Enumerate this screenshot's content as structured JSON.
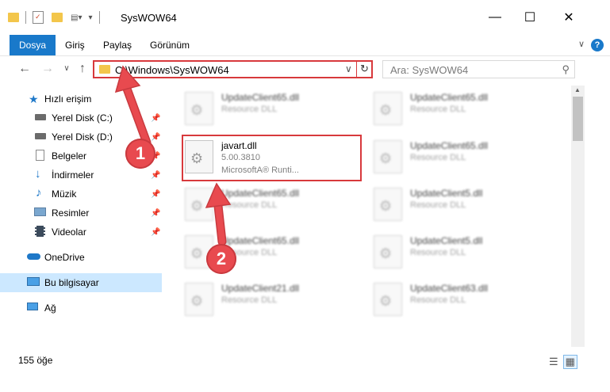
{
  "window": {
    "title": "SysWOW64",
    "minimize": "—",
    "maximize": "☐",
    "close": "✕"
  },
  "ribbon": {
    "tabs": [
      "Dosya",
      "Giriş",
      "Paylaş",
      "Görünüm"
    ],
    "help": "?",
    "collapse": "∨"
  },
  "nav": {
    "back": "←",
    "forward": "→",
    "recent": "∨",
    "up": "↑",
    "address": "C:\\Windows\\SysWOW64",
    "refresh": "↻",
    "search_placeholder": "Ara: SysWOW64",
    "search_icon": "search-icon"
  },
  "navpane": {
    "items": [
      {
        "label": "Hızlı erişim",
        "icon": "star-icon"
      },
      {
        "label": "Yerel Disk (C:)",
        "icon": "drive-icon",
        "pinned": true
      },
      {
        "label": "Yerel Disk (D:)",
        "icon": "drive-icon",
        "pinned": true
      },
      {
        "label": "Belgeler",
        "icon": "documents-icon",
        "pinned": true
      },
      {
        "label": "İndirmeler",
        "icon": "download-icon",
        "pinned": true
      },
      {
        "label": "Müzik",
        "icon": "music-icon",
        "pinned": true
      },
      {
        "label": "Resimler",
        "icon": "pictures-icon",
        "pinned": true
      },
      {
        "label": "Videolar",
        "icon": "video-icon",
        "pinned": true
      },
      {
        "label": "OneDrive",
        "icon": "cloud-icon"
      },
      {
        "label": "Bu bilgisayar",
        "icon": "computer-icon",
        "selected": true
      },
      {
        "label": "Ağ",
        "icon": "network-icon"
      }
    ]
  },
  "files": [
    {
      "name": "UpdateClient65.dll",
      "desc": "Resource DLL",
      "blurred": true
    },
    {
      "name": "UpdateClient65.dll",
      "desc": "Resource DLL",
      "blurred": true
    },
    {
      "name": "javart.dll",
      "desc": "5.00.3810",
      "desc2": "MicrosoftA® Runti...",
      "blurred": false,
      "highlighted": true
    },
    {
      "name": "UpdateClient65.dll",
      "desc": "Resource DLL",
      "blurred": true
    },
    {
      "name": "UpdateClient65.dll",
      "desc": "Resource DLL",
      "blurred": true
    },
    {
      "name": "UpdateClient5.dll",
      "desc": "Resource DLL",
      "blurred": true
    },
    {
      "name": "UpdateClient65.dll",
      "desc": "Resource DLL",
      "blurred": true
    },
    {
      "name": "UpdateClient5.dll",
      "desc": "Resource DLL",
      "blurred": true
    },
    {
      "name": "UpdateClient21.dll",
      "desc": "Resource DLL",
      "blurred": true
    },
    {
      "name": "UpdateClient63.dll",
      "desc": "Resource DLL",
      "blurred": true
    }
  ],
  "status": {
    "count": "155 öğe"
  },
  "annotations": {
    "badge1": "1",
    "badge2": "2",
    "color": "#e84a4f"
  },
  "colors": {
    "accent": "#1979ca",
    "highlight": "#d8393c",
    "selected_bg": "#cce8ff"
  }
}
